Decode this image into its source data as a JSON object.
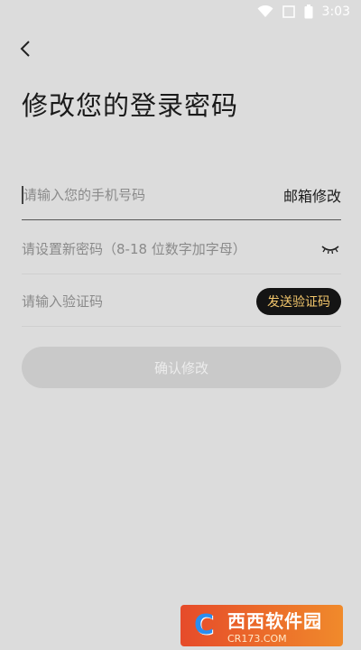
{
  "status_bar": {
    "time": "3:03",
    "icons": [
      "wifi-icon",
      "signal-icon",
      "battery-icon"
    ]
  },
  "header": {
    "back_icon": "chevron-left-icon",
    "title": "修改您的登录密码"
  },
  "form": {
    "phone": {
      "placeholder": "请输入您的手机号码",
      "value": ""
    },
    "email_switch_label": "邮箱修改",
    "password": {
      "placeholder": "请设置新密码（8-18 位数字加字母）",
      "value": ""
    },
    "password_toggle_icon": "eye-closed-icon",
    "code": {
      "placeholder": "请输入验证码",
      "value": ""
    },
    "send_code_label": "发送验证码",
    "confirm_label": "确认修改"
  },
  "watermark": {
    "main_text": "西西软件园",
    "sub_text": "CR173.COM"
  },
  "colors": {
    "background": "#dcdcdc",
    "send_button_bg": "#141414",
    "send_button_text": "#f2c66b",
    "confirm_disabled_bg": "#c9c9c9",
    "confirm_disabled_text": "#ececec"
  }
}
